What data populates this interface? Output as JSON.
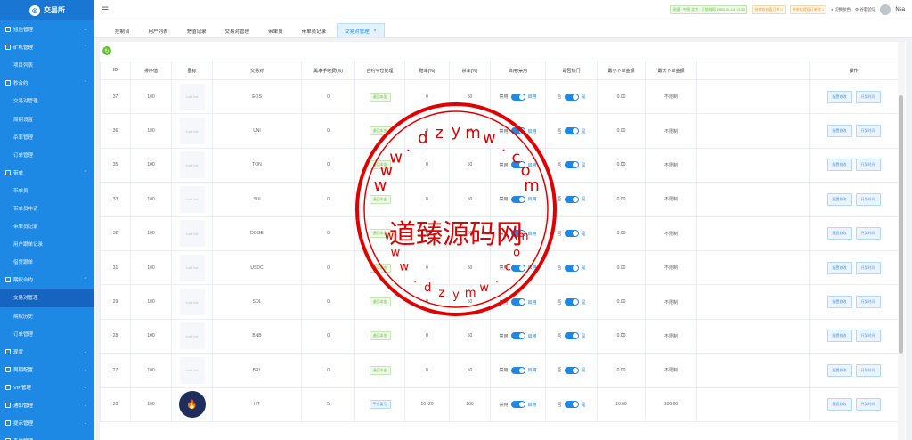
{
  "app": {
    "title": "交易所"
  },
  "topbar": {
    "tag1": "测速 · 中国 北京 · 当前时间 2025-08-14 20:35",
    "tag2": "待审核充值订单 0",
    "tag3": "待审核提现订单数 1",
    "switch_color": "切换肤色",
    "verify": "谷歌验证",
    "username": "Nsa"
  },
  "sidebar": {
    "items": [
      {
        "label": "短信管理",
        "type": "parent",
        "arrow": "⌄"
      },
      {
        "label": "矿机管理",
        "type": "parent",
        "arrow": "⌃"
      },
      {
        "label": "项目列表",
        "type": "sub"
      },
      {
        "label": "秒合约",
        "type": "parent",
        "arrow": "⌃"
      },
      {
        "label": "交易对管理",
        "type": "sub"
      },
      {
        "label": "周期设置",
        "type": "sub"
      },
      {
        "label": "杀率管理",
        "type": "sub"
      },
      {
        "label": "订单管理",
        "type": "sub"
      },
      {
        "label": "带单",
        "type": "parent",
        "arrow": "⌃"
      },
      {
        "label": "带单员",
        "type": "sub"
      },
      {
        "label": "带单员申请",
        "type": "sub"
      },
      {
        "label": "带单员记录",
        "type": "sub"
      },
      {
        "label": "用户跟单记录",
        "type": "sub"
      },
      {
        "label": "借贷跟单",
        "type": "sub"
      },
      {
        "label": "期权合约",
        "type": "parent",
        "arrow": "⌃"
      },
      {
        "label": "交易对管理",
        "type": "sub",
        "active": true
      },
      {
        "label": "期权历史",
        "type": "sub"
      },
      {
        "label": "订单管理",
        "type": "sub"
      },
      {
        "label": "现货",
        "type": "parent",
        "arrow": "⌄"
      },
      {
        "label": "周期配置",
        "type": "parent",
        "arrow": "⌄"
      },
      {
        "label": "VIP管理",
        "type": "parent",
        "arrow": "⌄"
      },
      {
        "label": "通知管理",
        "type": "parent",
        "arrow": "⌄"
      },
      {
        "label": "提示管理",
        "type": "parent",
        "arrow": "⌄"
      },
      {
        "label": "系统管理",
        "type": "parent",
        "arrow": "⌄"
      }
    ]
  },
  "tabs": [
    {
      "label": "控制台"
    },
    {
      "label": "用户列表"
    },
    {
      "label": "充值记录"
    },
    {
      "label": "交易对管理"
    },
    {
      "label": "带单员"
    },
    {
      "label": "带单员记录"
    },
    {
      "label": "交易对管理",
      "active": true,
      "close": "×"
    }
  ],
  "table": {
    "columns": [
      "ID",
      "排序值",
      "图标",
      "交易对",
      "黑家手续费(%)",
      "合约平仓处理",
      "赔率(%)",
      "杀率(%)",
      "启用/禁用",
      "是否热门",
      "最小下单金额",
      "最大下单金额",
      "",
      "操作"
    ],
    "placeholder": "load fail",
    "disabled_label": "禁用",
    "enabled_label": "启用",
    "no_label": "否",
    "yes_label": "是",
    "btn_config": "配置修改",
    "btn_time": "开奖时间",
    "rows": [
      {
        "id": "37",
        "sort": "100",
        "icon": "placeholder",
        "pair": "EOS",
        "fee": "0",
        "close": "退回本金",
        "close_style": "green",
        "odds": "0",
        "kill": "50",
        "min": "0.00",
        "max": "不限制"
      },
      {
        "id": "36",
        "sort": "100",
        "icon": "placeholder",
        "pair": "UNI",
        "fee": "0",
        "close": "退回本金",
        "close_style": "green",
        "odds": "0",
        "kill": "50",
        "min": "0.00",
        "max": "不限制"
      },
      {
        "id": "35",
        "sort": "100",
        "icon": "placeholder",
        "pair": "TON",
        "fee": "0",
        "close": "退回本金",
        "close_style": "green",
        "odds": "0",
        "kill": "50",
        "min": "0.00",
        "max": "不限制"
      },
      {
        "id": "33",
        "sort": "100",
        "icon": "placeholder",
        "pair": "SUI",
        "fee": "0",
        "close": "退回本金",
        "close_style": "green",
        "odds": "0",
        "kill": "50",
        "min": "0.00",
        "max": "不限制"
      },
      {
        "id": "32",
        "sort": "100",
        "icon": "placeholder",
        "pair": "DOGE",
        "fee": "0",
        "close": "退回本金",
        "close_style": "green",
        "odds": "0",
        "kill": "50",
        "min": "0.00",
        "max": "不限制"
      },
      {
        "id": "31",
        "sort": "100",
        "icon": "placeholder",
        "pair": "USDC",
        "fee": "0",
        "close": "退回本金",
        "close_style": "green",
        "odds": "0",
        "kill": "50",
        "min": "0.00",
        "max": "不限制"
      },
      {
        "id": "29",
        "sort": "100",
        "icon": "placeholder",
        "pair": "SOL",
        "fee": "0",
        "close": "退回本金",
        "close_style": "green",
        "odds": "0",
        "kill": "50",
        "min": "0.00",
        "max": "不限制"
      },
      {
        "id": "28",
        "sort": "100",
        "icon": "placeholder",
        "pair": "BNB",
        "fee": "0",
        "close": "退回本金",
        "close_style": "green",
        "odds": "0",
        "kill": "50",
        "min": "0.00",
        "max": "不限制"
      },
      {
        "id": "27",
        "sort": "100",
        "icon": "placeholder",
        "pair": "BRL",
        "fee": "0",
        "close": "退回本金",
        "close_style": "green",
        "odds": "0",
        "kill": "50",
        "min": "0.00",
        "max": "不限制"
      },
      {
        "id": "20",
        "sort": "100",
        "icon": "ht",
        "pair": "HT",
        "fee": "5",
        "close": "平仓盈亏",
        "close_style": "blue",
        "odds": "10~20",
        "kill": "100",
        "min": "10.00",
        "max": "100.00"
      }
    ]
  },
  "watermark": {
    "main": "道臻源码网",
    "domain": "www.dzymw.com",
    "color": "#e00000"
  },
  "colors": {
    "primary": "#1e88e5",
    "success": "#67c23a"
  }
}
